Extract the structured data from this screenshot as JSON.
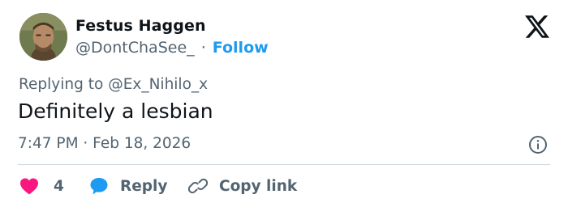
{
  "author": {
    "name": "Festus Haggen",
    "handle": "@DontChaSee_",
    "separator": "·",
    "follow_label": "Follow"
  },
  "tweet": {
    "replying_prefix": "Replying to",
    "replying_to": "@Ex_Nihilo_x",
    "text": "Definitely a lesbian",
    "timestamp": "7:47 PM · Feb 18, 2026"
  },
  "actions": {
    "like_count": "4",
    "reply_label": "Reply",
    "copy_link_label": "Copy link"
  },
  "colors": {
    "follow_link": "#1d9bf0",
    "like_heart": "#f91880",
    "reply_bubble": "#1d9bf0",
    "secondary_text": "#536471",
    "divider": "#cfd9de"
  },
  "icons": {
    "avatar": "avatar-photo",
    "platform_logo": "x-logo-icon",
    "info": "info-circle-icon",
    "like": "heart-icon",
    "reply": "speech-bubble-icon",
    "copy_link": "link-icon"
  }
}
